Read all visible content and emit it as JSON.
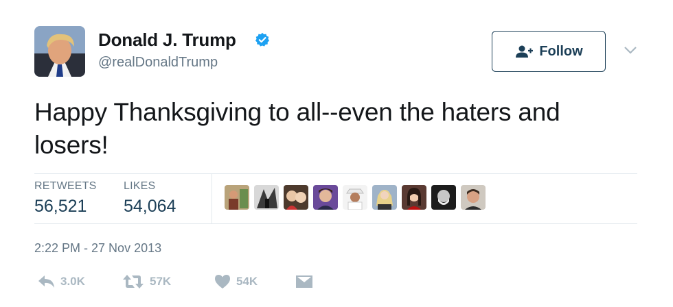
{
  "user": {
    "display_name": "Donald J. Trump",
    "handle": "@realDonaldTrump",
    "verified": true
  },
  "follow_button": {
    "label": "Follow"
  },
  "tweet": {
    "text": "Happy Thanksgiving to all--even the haters and losers!",
    "timestamp": "2:22 PM - 27 Nov 2013"
  },
  "stats": {
    "retweets_label": "RETWEETS",
    "retweets_value": "56,521",
    "likes_label": "LIKES",
    "likes_value": "54,064"
  },
  "liker_avatars_count": 9,
  "actions": {
    "reply_count": "3.0K",
    "retweet_count": "57K",
    "like_count": "54K"
  },
  "colors": {
    "text": "#14171a",
    "muted": "#657786",
    "stat_value": "#1c3f57",
    "verified_blue": "#1da1f2",
    "action_gray": "#aab8c2",
    "divider": "#e1e8ed"
  },
  "icons": [
    "verified-badge-icon",
    "follow-user-icon",
    "chevron-down-icon",
    "reply-icon",
    "retweet-icon",
    "heart-icon",
    "direct-message-icon"
  ]
}
